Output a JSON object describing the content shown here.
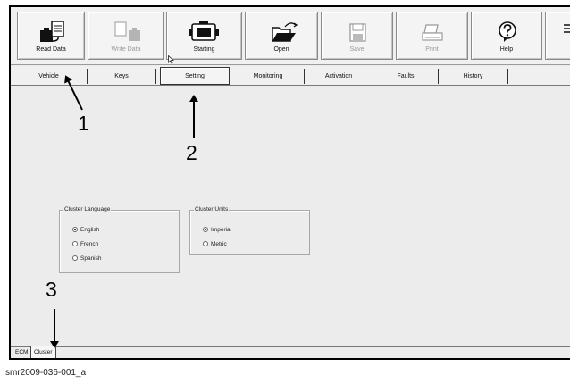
{
  "toolbar": {
    "buttons": [
      {
        "label": "Read Data",
        "icon": "read-data-icon",
        "enabled": true
      },
      {
        "label": "Write Data",
        "icon": "write-data-icon",
        "enabled": false
      },
      {
        "label": "Starting",
        "icon": "engine-icon",
        "enabled": true
      },
      {
        "label": "Open",
        "icon": "folder-open-icon",
        "enabled": true
      },
      {
        "label": "Save",
        "icon": "floppy-disk-icon",
        "enabled": false
      },
      {
        "label": "Print",
        "icon": "printer-icon",
        "enabled": false
      },
      {
        "label": "Help",
        "icon": "help-icon",
        "enabled": true
      }
    ]
  },
  "tabs": [
    {
      "label": "Vehicle"
    },
    {
      "label": "Keys"
    },
    {
      "label": "Setting",
      "active": true
    },
    {
      "label": "Monitoring"
    },
    {
      "label": "Activation"
    },
    {
      "label": "Faults"
    },
    {
      "label": "History"
    }
  ],
  "cluster_language": {
    "title": "Cluster Language",
    "options": [
      {
        "label": "English",
        "selected": true
      },
      {
        "label": "French",
        "selected": false
      },
      {
        "label": "Spanish",
        "selected": false
      }
    ]
  },
  "cluster_units": {
    "title": "Cluster Units",
    "options": [
      {
        "label": "Imperial",
        "selected": true
      },
      {
        "label": "Metric",
        "selected": false
      }
    ]
  },
  "bottom_tabs": [
    {
      "label": "ECM"
    },
    {
      "label": "Cluster",
      "active": true
    }
  ],
  "callouts": [
    "1",
    "2",
    "3"
  ],
  "caption": "smr2009-036-001_a"
}
